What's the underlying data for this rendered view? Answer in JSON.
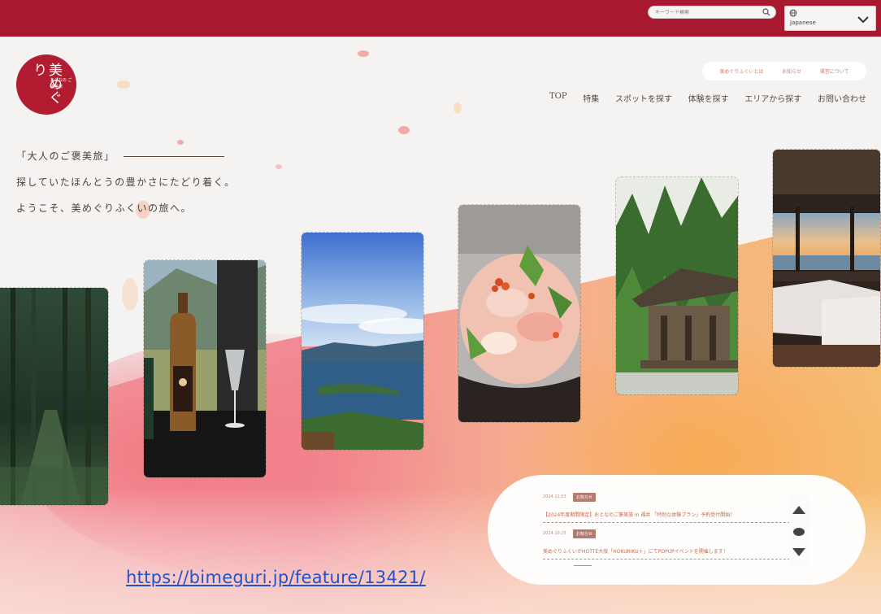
{
  "header": {
    "search_placeholder": "キーワード検索",
    "language": "Japanese"
  },
  "logo": {
    "main_text": "美めぐり",
    "sub_text": "おとなの ご褒美旅"
  },
  "subnav": [
    "美めぐりふくいとは",
    "お知らせ",
    "運営について"
  ],
  "nav": [
    "TOP",
    "特集",
    "スポットを探す",
    "体験を探す",
    "エリアから探す",
    "お問い合わせ"
  ],
  "hero": {
    "line1": "「大人のご褒美旅」",
    "line2": "探していたほんとうの豊かさにたどり着く。",
    "line3": "ようこそ、美めぐりふくいの旅へ。"
  },
  "cards": [
    {
      "name": "cedar-forest-path"
    },
    {
      "name": "plum-wine-bottle"
    },
    {
      "name": "lake-view"
    },
    {
      "name": "seafood-bowl"
    },
    {
      "name": "temple-in-forest"
    },
    {
      "name": "ocean-view-bedroom"
    }
  ],
  "news": {
    "items": [
      {
        "date": "2024.11.03",
        "badge": "お知らせ",
        "title": "【2024年度期間限定】おとなのご褒美旅 in 福井 「特別な体験プラン」予約受付開始！"
      },
      {
        "date": "2024.10.25",
        "badge": "お知らせ",
        "title": "美めぐりふくいがHOTTE大阪「HOKURIKU＋」にてPOPUPイベントを開催します！"
      }
    ]
  },
  "url": "https://bimeguri.jp/feature/13421/",
  "colors": {
    "brand_red": "#a8182f",
    "logo_red": "#b21c31",
    "link_blue": "#2552c4"
  }
}
